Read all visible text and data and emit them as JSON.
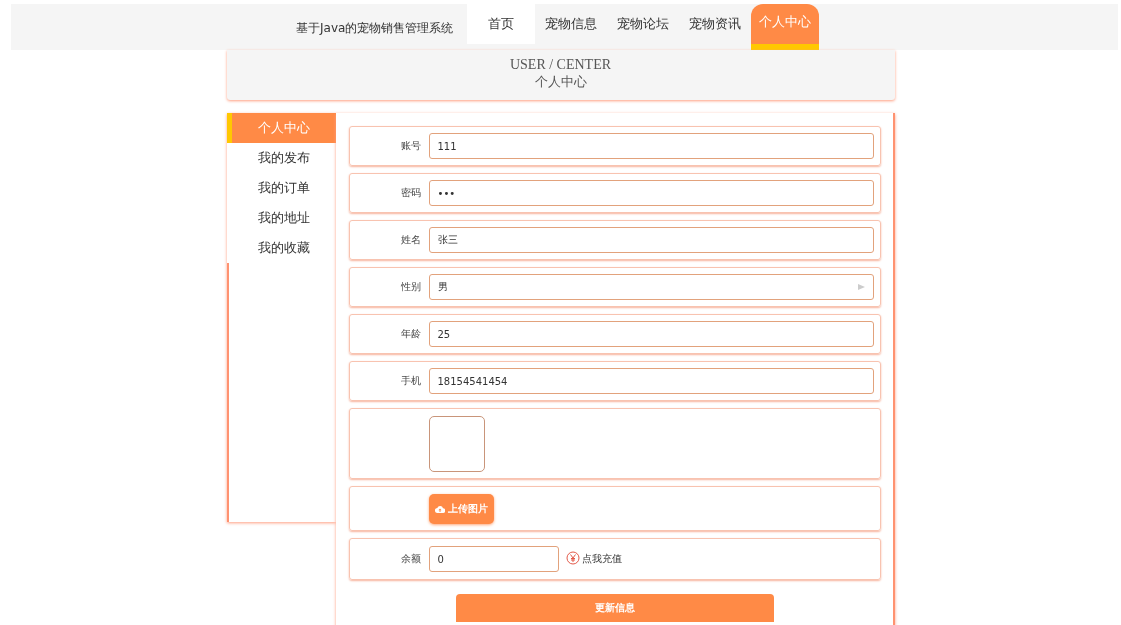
{
  "site_title": "基于Java的宠物销售管理系统",
  "nav": [
    {
      "label": "首页",
      "selected": false,
      "home": true
    },
    {
      "label": "宠物信息",
      "selected": false,
      "home": false
    },
    {
      "label": "宠物论坛",
      "selected": false,
      "home": false
    },
    {
      "label": "宠物资讯",
      "selected": false,
      "home": false
    },
    {
      "label": "个人中心",
      "selected": true,
      "home": false
    }
  ],
  "header": {
    "title": "USER / CENTER",
    "subtitle": "个人中心"
  },
  "sidebar": {
    "items": [
      {
        "label": "个人中心",
        "selected": true
      },
      {
        "label": "我的发布",
        "selected": false
      },
      {
        "label": "我的订单",
        "selected": false
      },
      {
        "label": "我的地址",
        "selected": false
      },
      {
        "label": "我的收藏",
        "selected": false
      }
    ]
  },
  "form": {
    "fields": [
      {
        "kind": "text",
        "label": "账号",
        "value": "111"
      },
      {
        "kind": "password",
        "label": "密码",
        "value": "•••"
      },
      {
        "kind": "text",
        "label": "姓名",
        "value": "张三"
      },
      {
        "kind": "select",
        "label": "性别",
        "value": "男"
      },
      {
        "kind": "text",
        "label": "年龄",
        "value": "25"
      },
      {
        "kind": "text",
        "label": "手机",
        "value": "18154541454"
      },
      {
        "kind": "image"
      },
      {
        "kind": "upload",
        "button": "上传图片"
      },
      {
        "kind": "balance",
        "label": "余额",
        "value": "0",
        "link": "点我充值"
      }
    ],
    "submit": "更新信息"
  }
}
